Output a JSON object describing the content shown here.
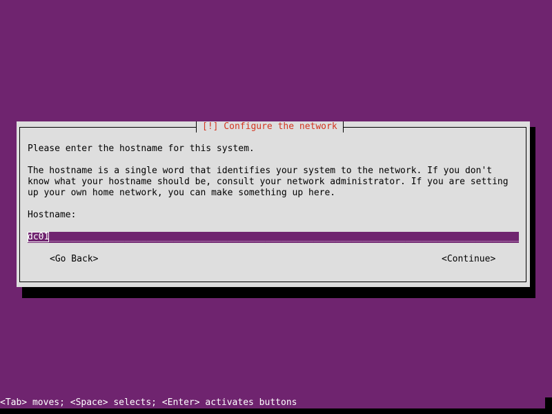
{
  "dialog": {
    "title": "[!] Configure the network",
    "prompt": "Please enter the hostname for this system.",
    "description": [
      "The hostname is a single word that identifies your system to the network. If you don't",
      "know what your hostname should be, consult your network administrator. If you are setting",
      "up your own home network, you can make something up here."
    ],
    "field_label": "Hostname:",
    "field_value": "dc01",
    "back_label": "<Go Back>",
    "continue_label": "<Continue>"
  },
  "status_bar": "<Tab> moves; <Space> selects; <Enter> activates buttons",
  "colors": {
    "background": "#6f246f",
    "dialog": "#dedede",
    "title": "#d3341f"
  }
}
